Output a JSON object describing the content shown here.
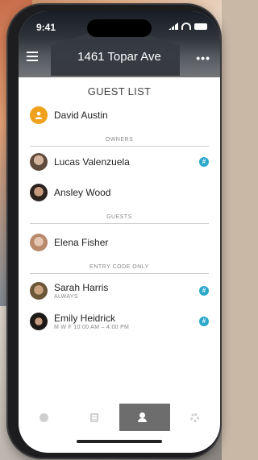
{
  "status": {
    "time": "9:41"
  },
  "header": {
    "address": "1461 Topar Ave",
    "more_label": "•••"
  },
  "title": "GUEST LIST",
  "primary": {
    "name": "David Austin",
    "avatar_color": "#f0a11c"
  },
  "sections": {
    "owners": "OWNERS",
    "guests": "GUESTS",
    "entry": "ENTRY CODE ONLY"
  },
  "owners": [
    {
      "name": "Lucas Valenzuela",
      "avatar_color": "#8a6a55",
      "code_icon": "#"
    },
    {
      "name": "Ansley Wood",
      "avatar_color": "#6a5545"
    }
  ],
  "guests": [
    {
      "name": "Elena Fisher",
      "avatar_color": "#c9a58e"
    }
  ],
  "entry_only": [
    {
      "name": "Sarah Harris",
      "schedule": "ALWAYS",
      "avatar_color": "#7b6a4d",
      "code_icon": "#"
    },
    {
      "name": "Emily Heidrick",
      "schedule": "M W F 10:00 AM – 4:00 PM",
      "avatar_color": "#3b332e",
      "code_icon": "#"
    }
  ],
  "colors": {
    "accent": "#2aa7c9",
    "primary_badge": "#f0a11c",
    "active_tab": "#6d6d6d"
  },
  "tabs": [
    {
      "icon": "dot-icon"
    },
    {
      "icon": "list-icon"
    },
    {
      "icon": "people-icon",
      "active": true
    },
    {
      "icon": "gear-icon"
    }
  ]
}
